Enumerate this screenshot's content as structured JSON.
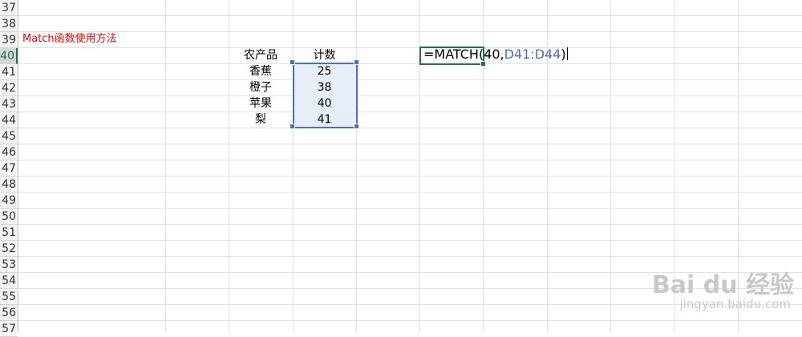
{
  "rows": [
    "37",
    "38",
    "39",
    "40",
    "41",
    "42",
    "43",
    "44",
    "45",
    "46",
    "47",
    "48",
    "49",
    "50",
    "51",
    "52",
    "53",
    "54",
    "55",
    "56",
    "57"
  ],
  "active_row": "40",
  "title_cell": "Match函数使用方法",
  "table": {
    "headers": [
      "农产品",
      "计数"
    ],
    "rows": [
      {
        "product": "香蕉",
        "count": "25"
      },
      {
        "product": "橙子",
        "count": "38"
      },
      {
        "product": "苹果",
        "count": "40"
      },
      {
        "product": "梨",
        "count": "41"
      }
    ]
  },
  "formula": {
    "prefix": "=MATCH(40,",
    "range": "D41:D44",
    "suffix": ")"
  },
  "watermark": {
    "brand": "Bai du 经验",
    "url": "jingyan.baidu.com"
  },
  "colors": {
    "title": "#ff0000",
    "range_ref": "#4472c4",
    "active_border": "#217346"
  }
}
